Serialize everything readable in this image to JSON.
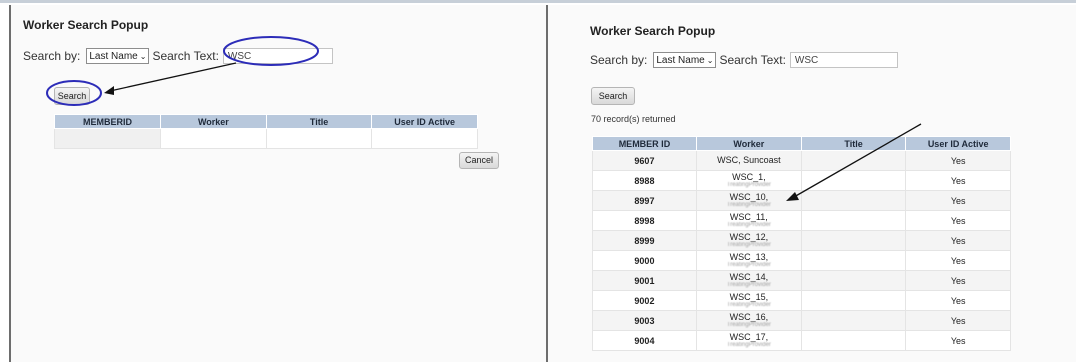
{
  "left": {
    "title": "Worker Search Popup",
    "search_by_label": "Search by:",
    "search_by_value": "Last Name",
    "search_text_label": "Search Text:",
    "search_text_value": "WSC",
    "search_button": "Search",
    "columns": [
      "MEMBERID",
      "Worker",
      "Title",
      "User ID Active"
    ],
    "cancel_button": "Cancel"
  },
  "right": {
    "title": "Worker Search Popup",
    "search_by_label": "Search by:",
    "search_by_value": "Last Name",
    "search_text_label": "Search Text:",
    "search_text_value": "WSC",
    "search_button": "Search",
    "records_returned": "70 record(s) returned",
    "columns": [
      "MEMBER ID",
      "Worker",
      "Title",
      "User ID Active"
    ],
    "rows": [
      {
        "id": "9607",
        "worker": "WSC, Suncoast",
        "worker_sub": "",
        "title": "",
        "active": "Yes"
      },
      {
        "id": "8988",
        "worker": "WSC_1,",
        "worker_sub": "TreatingProvider",
        "title": "",
        "active": "Yes"
      },
      {
        "id": "8997",
        "worker": "WSC_10,",
        "worker_sub": "TreatingProvider",
        "title": "",
        "active": "Yes"
      },
      {
        "id": "8998",
        "worker": "WSC_11,",
        "worker_sub": "TreatingProvider",
        "title": "",
        "active": "Yes"
      },
      {
        "id": "8999",
        "worker": "WSC_12,",
        "worker_sub": "TreatingProvider",
        "title": "",
        "active": "Yes"
      },
      {
        "id": "9000",
        "worker": "WSC_13,",
        "worker_sub": "TreatingProvider",
        "title": "",
        "active": "Yes"
      },
      {
        "id": "9001",
        "worker": "WSC_14,",
        "worker_sub": "TreatingProvider",
        "title": "",
        "active": "Yes"
      },
      {
        "id": "9002",
        "worker": "WSC_15,",
        "worker_sub": "TreatingProvider",
        "title": "",
        "active": "Yes"
      },
      {
        "id": "9003",
        "worker": "WSC_16,",
        "worker_sub": "TreatingProvider",
        "title": "",
        "active": "Yes"
      },
      {
        "id": "9004",
        "worker": "WSC_17,",
        "worker_sub": "TreatingProvider",
        "title": "",
        "active": "Yes"
      }
    ]
  },
  "colors": {
    "header": "#b8c8dc",
    "annotation": "#2c2cb8",
    "arrow": "#111111"
  }
}
